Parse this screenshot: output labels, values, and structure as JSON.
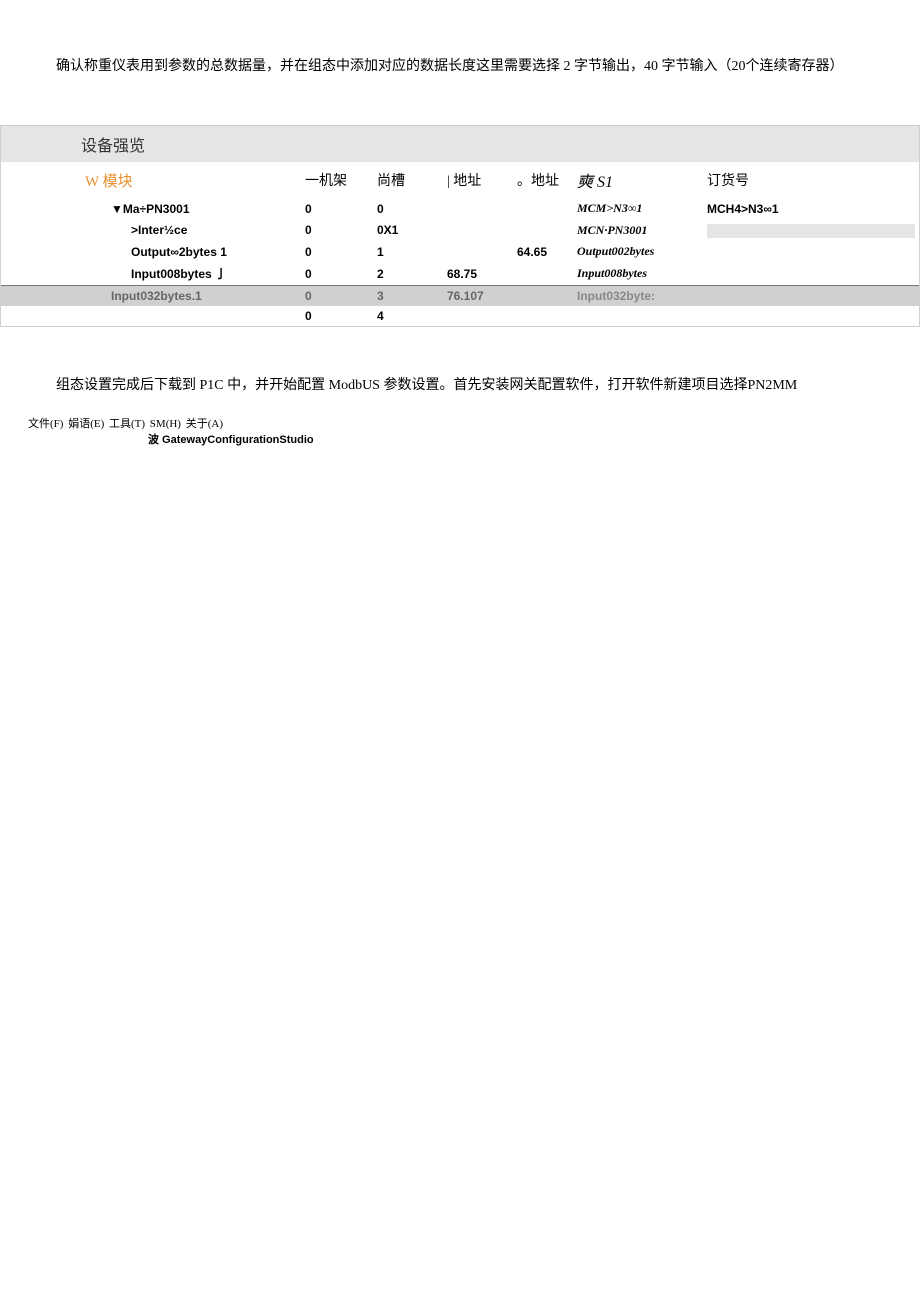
{
  "para1": "确认称重仪表用到参数的总数据量，并在组态中添加对应的数据长度这里需要选择 2 字节输出，40 字节输入（20个连续寄存器）",
  "panel_title": "设备强览",
  "headers": {
    "module": "W 模块",
    "rack": "一机架",
    "slot": "尚槽",
    "iaddr": "|  地址",
    "qaddr": "。地址",
    "type": "奭 S1",
    "order": "订货号"
  },
  "rows": [
    {
      "module": "▼Ma÷PN3001",
      "rack": "0",
      "slot": "0",
      "iaddr": "",
      "qaddr": "",
      "type": "MCM>N3∞1",
      "order": "MCH4>N3∞1",
      "cls": "indent1",
      "orderbox": false
    },
    {
      "module": ">Inter½ce",
      "rack": "0",
      "slot": "0X1",
      "iaddr": "",
      "qaddr": "",
      "type": "MCN·PN3001",
      "order": "",
      "cls": "indent2",
      "orderbox": true
    },
    {
      "module": "Output∞2bytes 1",
      "rack": "0",
      "slot": "1",
      "iaddr": "",
      "qaddr": "64.65",
      "type": "Output002bytes",
      "order": "",
      "cls": "indent2",
      "orderbox": false
    },
    {
      "module": "Input008bytes 亅",
      "rack": "0",
      "slot": "2",
      "iaddr": "68.75",
      "qaddr": "",
      "type": "Input008bytes",
      "order": "",
      "cls": "indent2 hr-row",
      "orderbox": false
    },
    {
      "module": "Input032bytes.1",
      "rack": "0",
      "slot": "3",
      "iaddr": "76.107",
      "qaddr": "",
      "type": "Input032byte:",
      "order": "",
      "cls": "indent1 sel-row",
      "orderbox": false
    },
    {
      "module": "",
      "rack": "0",
      "slot": "4",
      "iaddr": "",
      "qaddr": "",
      "type": "",
      "order": "",
      "cls": "",
      "orderbox": false
    }
  ],
  "para2": "组态设置完成后下载到 P1C 中，并开始配置 ModbUS 参数设置。首先安装网关配置软件，打开软件新建项目选择PN2MM",
  "menu": {
    "file": "文件(F)",
    "edit": "娟语(E)",
    "tool": "工具(T)",
    "sm": "SM(H)",
    "about": "关于(A)",
    "sub": "波 GatewayConfigurationStudio"
  }
}
